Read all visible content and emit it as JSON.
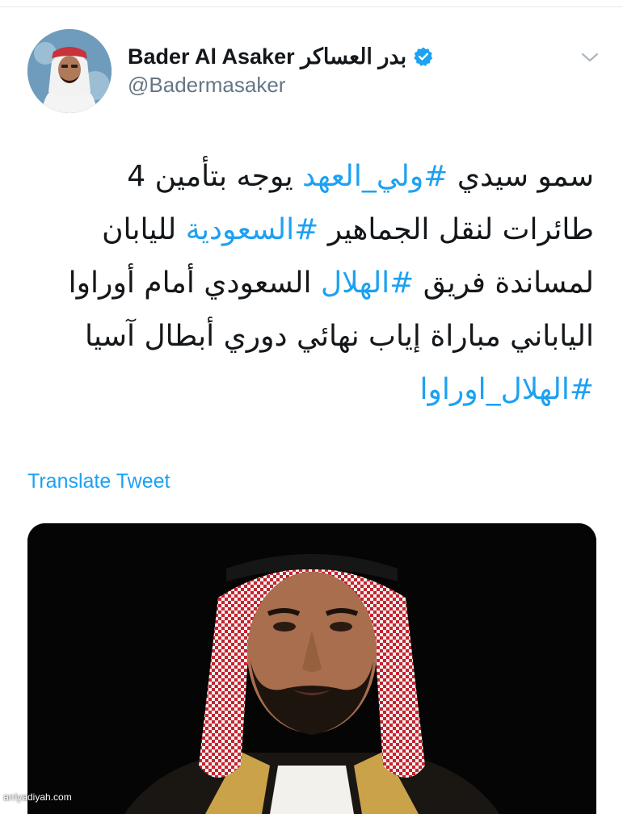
{
  "tweet": {
    "author": {
      "display_name": "Bader Al Asaker بدر العساكر",
      "handle": "@Badermasaker",
      "verified": true
    },
    "text_lines": [
      [
        {
          "t": "سمو سيدي ",
          "tag": false
        },
        {
          "t": "#ولي_العهد",
          "tag": true
        },
        {
          "t": " يوجه بتأمين 4",
          "tag": false
        }
      ],
      [
        {
          "t": "طائرات لنقل الجماهير ",
          "tag": false
        },
        {
          "t": "#السعودية",
          "tag": true
        },
        {
          "t": " لليابان",
          "tag": false
        }
      ],
      [
        {
          "t": "لمساندة فريق ",
          "tag": false
        },
        {
          "t": "#الهلال",
          "tag": true
        },
        {
          "t": " السعودي أمام أوراوا",
          "tag": false
        }
      ],
      [
        {
          "t": "الياباني مباراة إياب نهائي دوري أبطال آسيا",
          "tag": false
        }
      ],
      [
        {
          "t": "#الهلال_اوراوا",
          "tag": true
        }
      ]
    ],
    "translate_label": "Translate Tweet"
  },
  "icons": {
    "verified": "verified-badge-icon",
    "more": "chevron-down-icon"
  },
  "colors": {
    "link": "#1da1f2",
    "text": "#14171a",
    "secondary": "#657786",
    "verified": "#1da1f2"
  },
  "watermark": "arriyadiyah.com"
}
